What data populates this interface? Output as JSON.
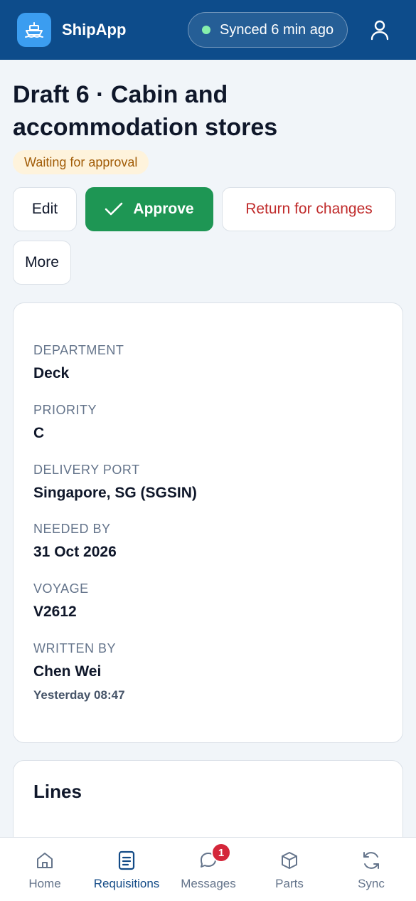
{
  "app": {
    "brand": "ShipApp"
  },
  "sync": {
    "status": "Synced 6 min ago"
  },
  "requisition": {
    "title": "Draft 6 · Cabin and accommodation stores",
    "status": "Waiting for approval"
  },
  "actions": {
    "edit": "Edit",
    "approve": "Approve",
    "return": "Return for changes",
    "more": "More"
  },
  "details": {
    "department": {
      "label": "DEPARTMENT",
      "value": "Deck"
    },
    "priority": {
      "label": "PRIORITY",
      "value": "C"
    },
    "delivery_port": {
      "label": "DELIVERY PORT",
      "value": "Singapore, SG (SGSIN)"
    },
    "needed_by": {
      "label": "NEEDED BY",
      "value": "31 Oct 2026"
    },
    "voyage": {
      "label": "VOYAGE",
      "value": "V2612"
    },
    "written_by": {
      "label": "WRITTEN BY",
      "value": "Chen Wei",
      "time": "Yesterday 08:47"
    }
  },
  "lines": {
    "title": "Lines"
  },
  "nav": {
    "home": "Home",
    "requisitions": "Requisitions",
    "messages": "Messages",
    "messages_badge": "1",
    "parts": "Parts",
    "sync": "Sync"
  },
  "colors": {
    "topbar": "#0d4c8b",
    "approve": "#1e9654",
    "return_text": "#c02b2b",
    "status_bg": "#fef3dc",
    "status_text": "#a15c07",
    "badge": "#d4263a"
  }
}
